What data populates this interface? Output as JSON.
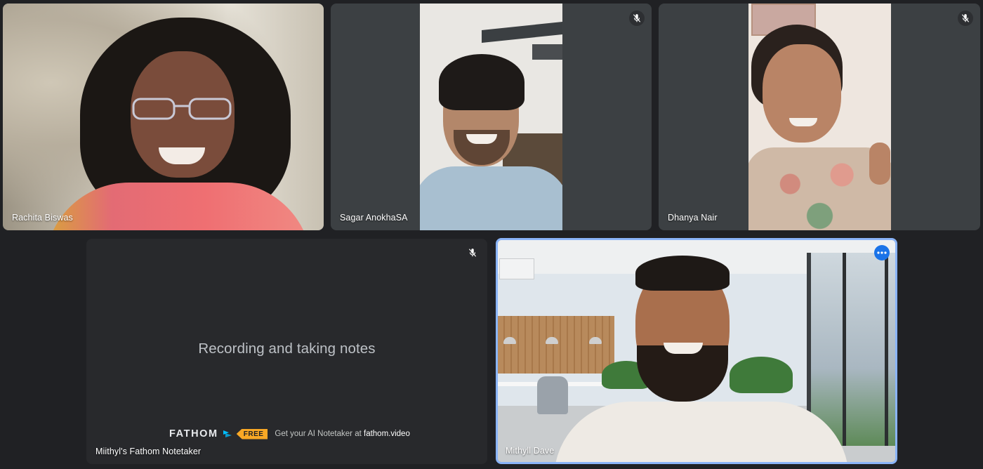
{
  "participants": [
    {
      "name": "Rachita Biswas",
      "mic_muted": false
    },
    {
      "name": "Sagar AnokhaSA",
      "mic_muted": true
    },
    {
      "name": "Dhanya Nair",
      "mic_muted": true
    },
    {
      "name": "Miithyl's Fathom Notetaker",
      "mic_muted": true,
      "status_text": "Recording and taking notes",
      "banner": {
        "brand": "FATHOM",
        "badge": "FREE",
        "cta_prefix": "Get your AI Notetaker at",
        "cta_link": "fathom.video"
      }
    },
    {
      "name": "Mithyll Dave",
      "mic_muted": false,
      "active_speaker": true,
      "more_options_icon": "more-horiz-icon"
    }
  ],
  "colors": {
    "background": "#202124",
    "tile": "#3c4043",
    "active_border": "#8ab4f8",
    "more_button": "#1a73e8",
    "free_badge": "#f9a825"
  }
}
